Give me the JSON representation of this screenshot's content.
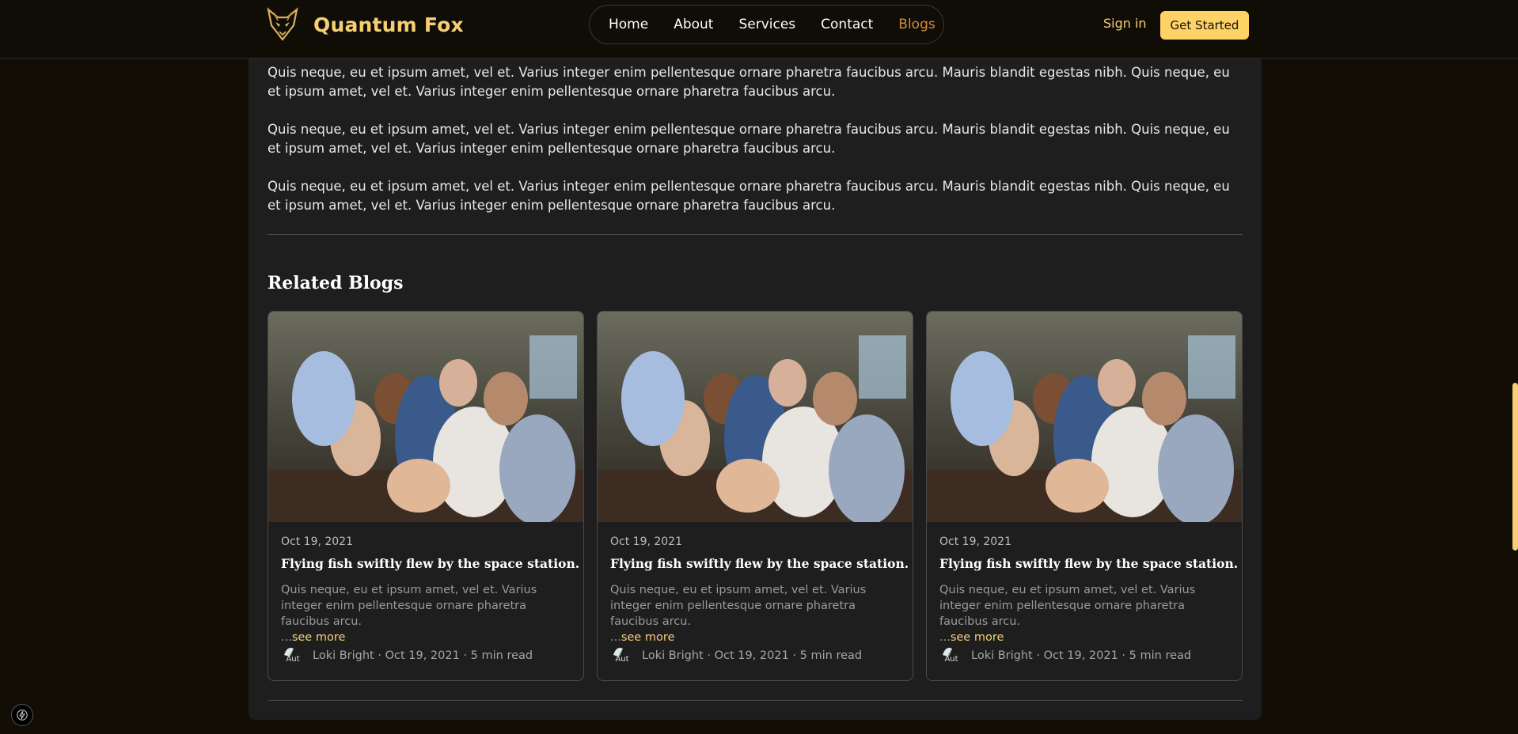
{
  "brand": {
    "name": "Quantum Fox",
    "logo_icon": "fox-logo-icon",
    "accent": "#f6cf73"
  },
  "nav": {
    "items": [
      {
        "label": "Home"
      },
      {
        "label": "About"
      },
      {
        "label": "Services"
      },
      {
        "label": "Contact"
      },
      {
        "label": "Blogs",
        "active": true,
        "color": "#d68a3c"
      }
    ],
    "sign_in": "Sign in",
    "get_started": "Get Started"
  },
  "article": {
    "paragraphs": [
      "Quis neque, eu et ipsum amet, vel et. Varius integer enim pellentesque ornare pharetra faucibus arcu. Mauris blandit egestas nibh. Quis neque, eu et ipsum amet, vel et. Varius integer enim pellentesque ornare pharetra faucibus arcu.",
      "Quis neque, eu et ipsum amet, vel et. Varius integer enim pellentesque ornare pharetra faucibus arcu. Mauris blandit egestas nibh. Quis neque, eu et ipsum amet, vel et. Varius integer enim pellentesque ornare pharetra faucibus arcu.",
      "Quis neque, eu et ipsum amet, vel et. Varius integer enim pellentesque ornare pharetra faucibus arcu. Mauris blandit egestas nibh. Quis neque, eu et ipsum amet, vel et. Varius integer enim pellentesque ornare pharetra faucibus arcu."
    ]
  },
  "related": {
    "title": "Related Blogs",
    "cards": [
      {
        "date": "Oct 19, 2021",
        "title": "Flying fish swiftly flew by the space station.",
        "excerpt": "Quis neque, eu et ipsum amet, vel et. Varius integer enim pellentesque ornare pharetra faucibus arcu.",
        "ellipsis": "...",
        "see_more": "see more",
        "avatar_alt": "Aut",
        "meta": "Loki Bright · Oct 19, 2021 · 5 min read"
      },
      {
        "date": "Oct 19, 2021",
        "title": "Flying fish swiftly flew by the space station.",
        "excerpt": "Quis neque, eu et ipsum amet, vel et. Varius integer enim pellentesque ornare pharetra faucibus arcu.",
        "ellipsis": "...",
        "see_more": "see more",
        "avatar_alt": "Aut",
        "meta": "Loki Bright · Oct 19, 2021 · 5 min read"
      },
      {
        "date": "Oct 19, 2021",
        "title": "Flying fish swiftly flew by the space station.",
        "excerpt": "Quis neque, eu et ipsum amet, vel et. Varius integer enim pellentesque ornare pharetra faucibus arcu.",
        "ellipsis": "...",
        "see_more": "see more",
        "avatar_alt": "Aut",
        "meta": "Loki Bright · Oct 19, 2021 · 5 min read"
      }
    ]
  },
  "icons": {
    "dev_indicator": "lightning-bolt-icon"
  }
}
